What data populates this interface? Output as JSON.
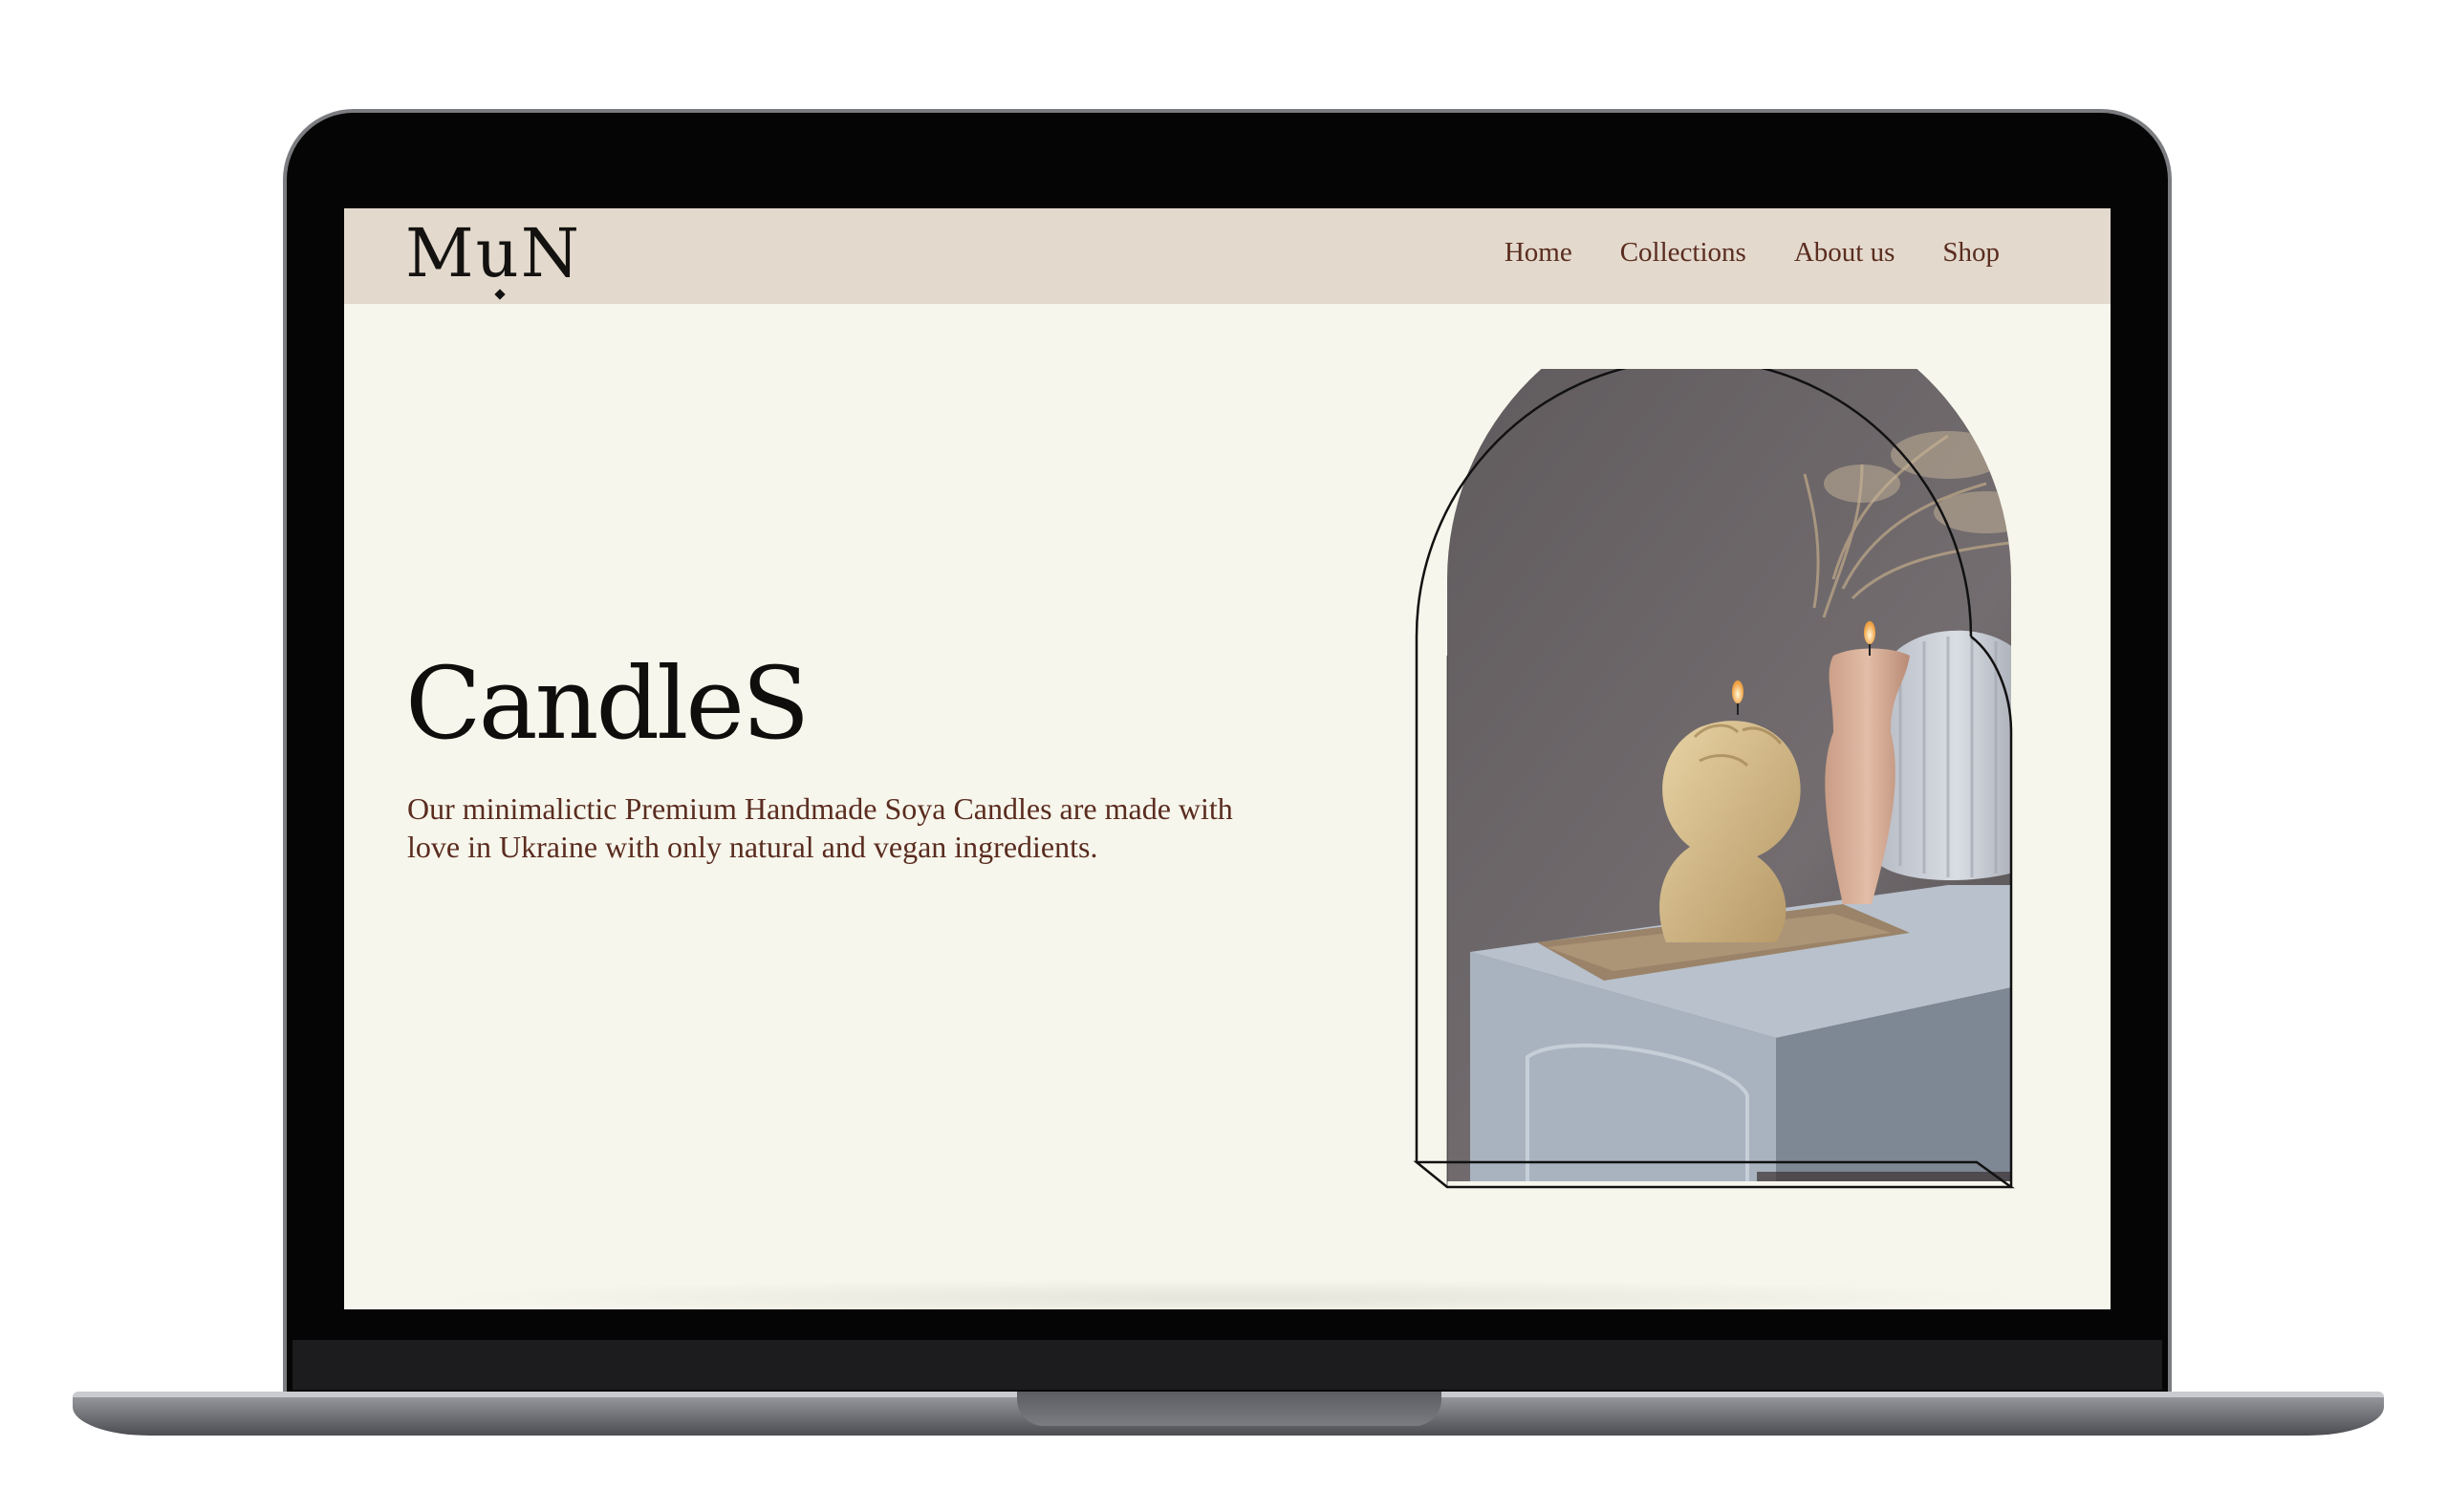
{
  "site": {
    "logo_text": "MuN"
  },
  "nav": {
    "items": [
      {
        "label": "Home"
      },
      {
        "label": "Collections"
      },
      {
        "label": "About us"
      },
      {
        "label": "Shop"
      }
    ]
  },
  "hero": {
    "title": "CandleS",
    "description": "Our minimalictic Premium Handmade Soya Candles are made with love in Ukraine with only natural and vegan ingredients."
  },
  "colors": {
    "navbar_bg": "#e3d9cd",
    "page_bg": "#f7f6ec",
    "text_brown": "#5a2c1f",
    "heading": "#0f0e0c"
  }
}
